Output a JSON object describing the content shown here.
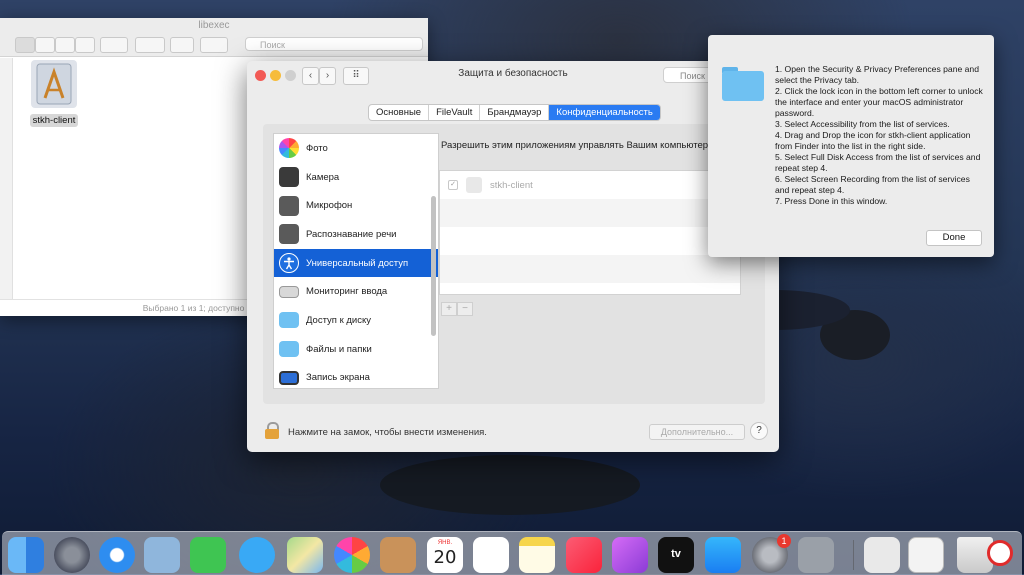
{
  "finder": {
    "title": "libexec",
    "search_placeholder": "Поиск",
    "file_name": "stkh-client",
    "status": "Выбрано 1 из 1; доступно 145,21 ГБ"
  },
  "security": {
    "title": "Защита и безопасность",
    "search_placeholder": "Поиск",
    "tabs": [
      {
        "label": "Основные"
      },
      {
        "label": "FileVault"
      },
      {
        "label": "Брандмауэр"
      },
      {
        "label": "Конфиденциальность"
      }
    ],
    "services": [
      {
        "label": "Фото",
        "icon": "photos-icon"
      },
      {
        "label": "Камера",
        "icon": "camera-icon"
      },
      {
        "label": "Микрофон",
        "icon": "microphone-icon"
      },
      {
        "label": "Распознавание речи",
        "icon": "speech-recognition-icon"
      },
      {
        "label": "Универсальный доступ",
        "icon": "accessibility-icon"
      },
      {
        "label": "Мониторинг ввода",
        "icon": "keyboard-icon"
      },
      {
        "label": "Доступ к диску",
        "icon": "folder-icon"
      },
      {
        "label": "Файлы и папки",
        "icon": "folder-icon"
      },
      {
        "label": "Запись экрана",
        "icon": "display-icon"
      }
    ],
    "right_caption": "Разрешить этим приложениям управлять Вашим компьютером.",
    "apps": [
      {
        "name": "stkh-client",
        "checked": true
      }
    ],
    "plus": "+",
    "minus": "−",
    "lock_text": "Нажмите на замок, чтобы внести изменения.",
    "advanced_label": "Дополнительно...",
    "help_label": "?"
  },
  "instructions": {
    "lines": [
      "1. Open the Security & Privacy Preferences pane and select the Privacy tab.",
      "2. Click the lock icon in the bottom left corner to unlock the interface and enter your macOS administrator password.",
      "3. Select Accessibility from the list of services.",
      "4. Drag and Drop the icon for stkh-client application from Finder into the list in the right side.",
      "5. Select Full Disk Access from the list of services and repeat step 4.",
      "6. Select Screen Recording from the list of services and repeat step 4.",
      "7. Press Done in this window."
    ],
    "done_label": "Done"
  },
  "dock": {
    "calendar_month": "ЯНВ.",
    "calendar_day": "20",
    "tv_label": "tv",
    "sysprefs_badge": "1"
  }
}
